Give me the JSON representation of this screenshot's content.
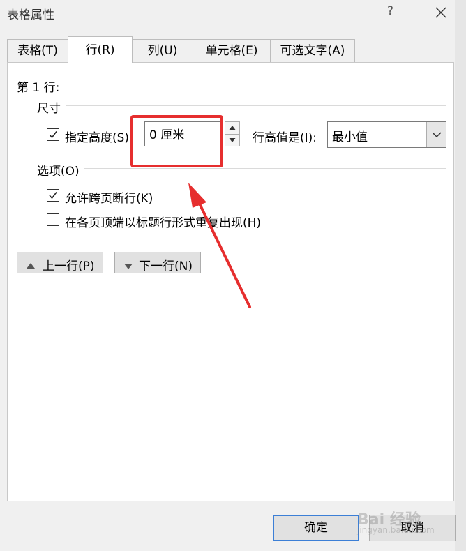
{
  "window": {
    "title": "表格属性",
    "help": "?"
  },
  "tabs": [
    {
      "label": "表格(T)",
      "active": false
    },
    {
      "label": "行(R)",
      "active": true
    },
    {
      "label": "列(U)",
      "active": false
    },
    {
      "label": "单元格(E)",
      "active": false
    },
    {
      "label": "可选文字(A)",
      "active": false
    }
  ],
  "row_panel": {
    "row_label": "第 1 行:",
    "size_group": "尺寸",
    "specify_height": {
      "label": "指定高度(S)",
      "checked": true
    },
    "height_value": "0 厘米",
    "row_height_is_label": "行高值是(I):",
    "row_height_mode": "最小值",
    "options_group": "选项(O)",
    "allow_break": {
      "label": "允许跨页断行(K)",
      "checked": true
    },
    "repeat_header": {
      "label": "在各页顶端以标题行形式重复出现(H)",
      "checked": false
    },
    "prev_row": "上一行(P)",
    "next_row": "下一行(N)"
  },
  "footer": {
    "ok": "确定",
    "cancel": "取消"
  },
  "annotation": {
    "highlight_color": "#e62e2e"
  },
  "watermark": {
    "main": "Bai 经验",
    "sub": "jingyan.baidu.com"
  }
}
